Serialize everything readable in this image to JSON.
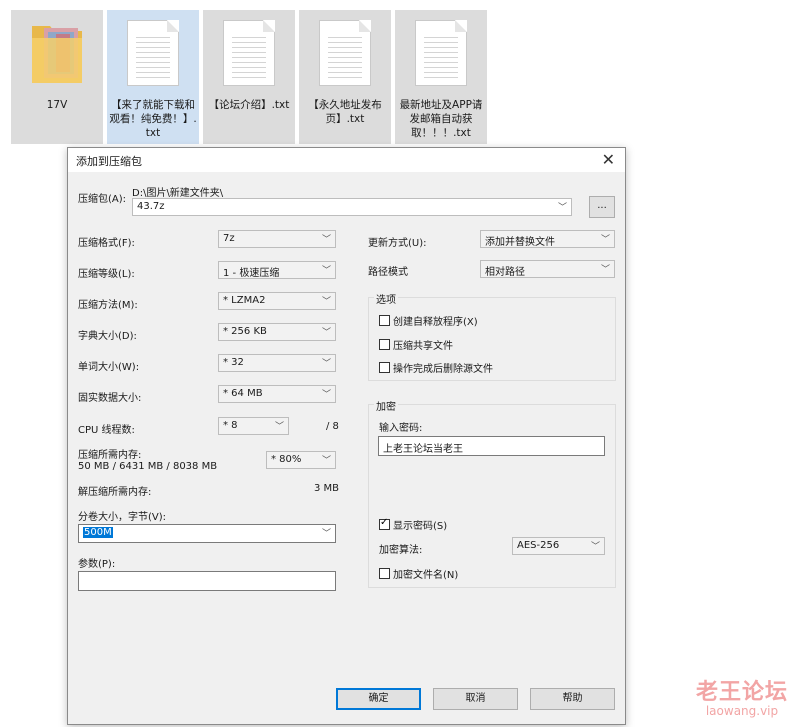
{
  "files": [
    {
      "name": "17V",
      "type": "folder"
    },
    {
      "name": "【来了就能下载和观看！纯免费！】.txt",
      "type": "txt"
    },
    {
      "name": "【论坛介绍】.txt",
      "type": "txt"
    },
    {
      "name": "【永久地址发布页】.txt",
      "type": "txt"
    },
    {
      "name": "最新地址及APP请发邮箱自动获取！！！.txt",
      "type": "txt"
    }
  ],
  "dialog": {
    "title": "添加到压缩包",
    "close": "✕",
    "archive_label": "压缩包(A):",
    "archive_path": "D:\\图片\\新建文件夹\\",
    "archive_name": "43.7z",
    "browse": "...",
    "left": {
      "format_label": "压缩格式(F):",
      "format_value": "7z",
      "level_label": "压缩等级(L):",
      "level_value": "1 - 极速压缩",
      "method_label": "压缩方法(M):",
      "method_value": "* LZMA2",
      "dict_label": "字典大小(D):",
      "dict_value": "* 256 KB",
      "word_label": "单词大小(W):",
      "word_value": "* 32",
      "solid_label": "固实数据大小:",
      "solid_value": "* 64 MB",
      "threads_label": "CPU 线程数:",
      "threads_value": "* 8",
      "threads_max": "/ 8",
      "mem_label": "压缩所需内存:",
      "mem_value": "50 MB / 6431 MB / 8038 MB",
      "mem_percent": "* 80%",
      "decomp_label": "解压缩所需内存:",
      "decomp_value": "3 MB",
      "split_label": "分卷大小，字节(V):",
      "split_value": "500M",
      "params_label": "参数(P):",
      "params_value": ""
    },
    "right": {
      "update_label": "更新方式(U):",
      "update_value": "添加并替换文件",
      "path_label": "路径模式",
      "path_value": "相对路径",
      "options_title": "选项",
      "opt_sfx": "创建自释放程序(X)",
      "opt_shared": "压缩共享文件",
      "opt_delete": "操作完成后删除源文件",
      "enc_title": "加密",
      "pwd_label": "输入密码:",
      "pwd_value": "上老王论坛当老王",
      "show_pwd": "显示密码(S)",
      "enc_method_label": "加密算法:",
      "enc_method_value": "AES-256",
      "enc_names": "加密文件名(N)"
    },
    "buttons": {
      "ok": "确定",
      "cancel": "取消",
      "help": "帮助"
    }
  },
  "watermark": {
    "line1": "老王论坛",
    "line2": "laowang.vip"
  }
}
